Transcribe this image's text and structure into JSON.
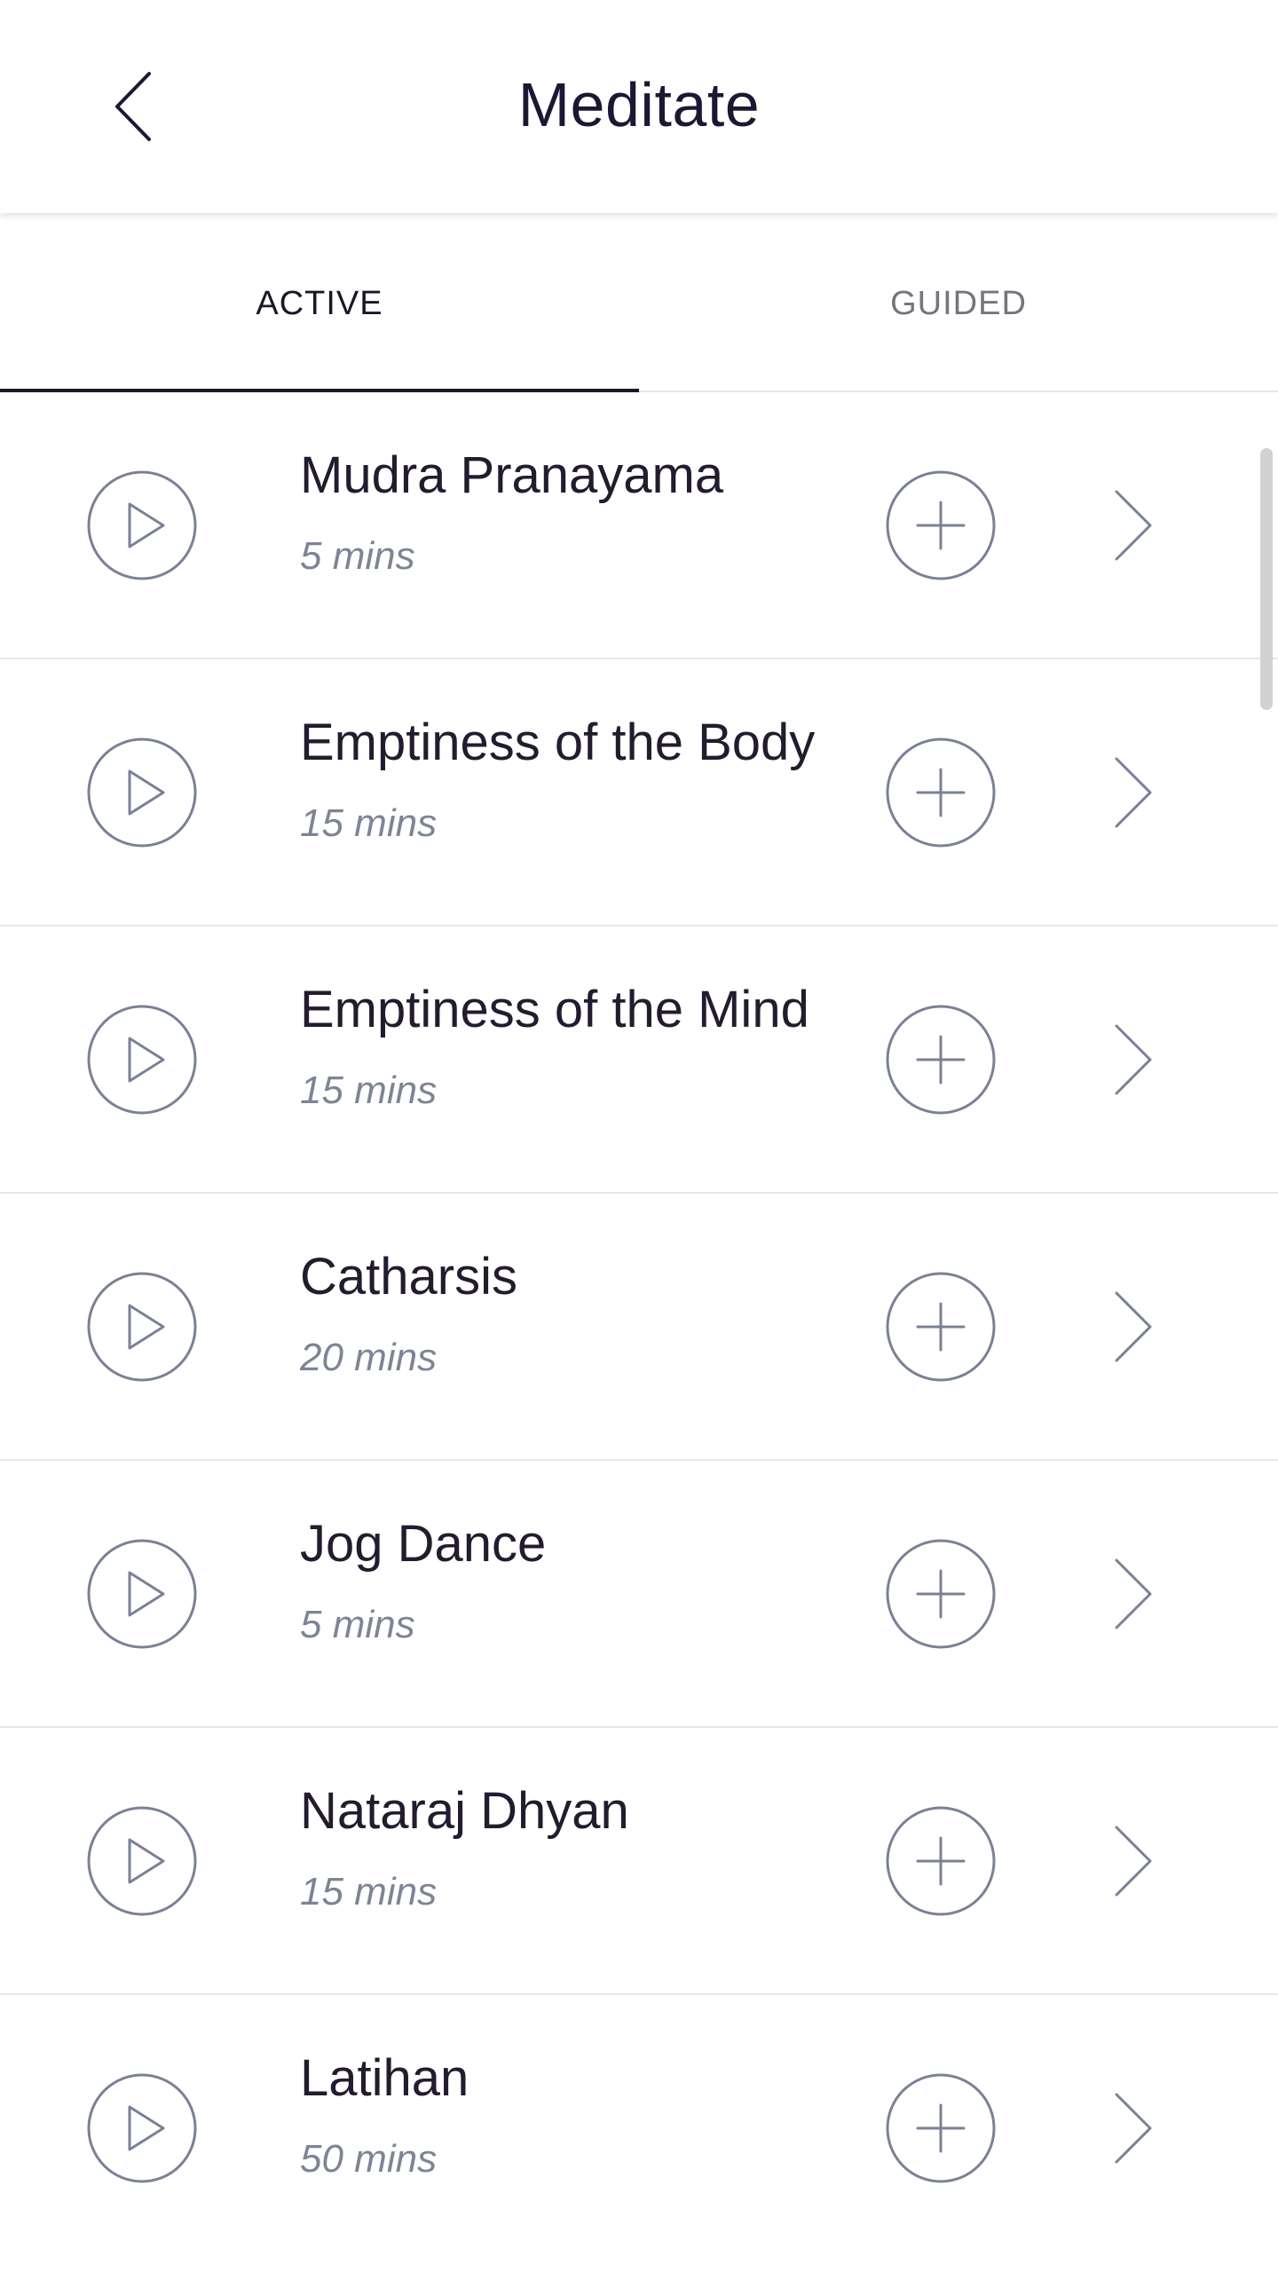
{
  "header": {
    "title": "Meditate",
    "back_icon": "chevron-left-icon"
  },
  "tabs": [
    {
      "label": "ACTIVE",
      "selected": true
    },
    {
      "label": "GUIDED",
      "selected": false
    }
  ],
  "colors": {
    "title_text": "#1c1733",
    "icon_stroke": "#7a8196",
    "duration_text": "#7d8495",
    "divider": "#e6e6ea",
    "active_tab_indicator": "#1d1629"
  },
  "items": [
    {
      "title": "Mudra Pranayama",
      "duration": "5 mins"
    },
    {
      "title": "Emptiness of the Body",
      "duration": "15 mins"
    },
    {
      "title": "Emptiness of the Mind",
      "duration": "15 mins"
    },
    {
      "title": "Catharsis",
      "duration": "20 mins"
    },
    {
      "title": "Jog Dance",
      "duration": "5 mins"
    },
    {
      "title": "Nataraj Dhyan",
      "duration": "15 mins"
    },
    {
      "title": "Latihan",
      "duration": "50 mins"
    }
  ]
}
